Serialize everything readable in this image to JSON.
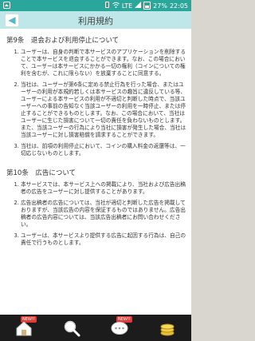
{
  "statusbar": {
    "carrier_icon": "app-icon",
    "network": "LTE",
    "battery": "27%",
    "time": "22:05"
  },
  "header": {
    "title": "利用規約",
    "back_icon": "back-icon"
  },
  "sections": [
    {
      "heading": "第9条　退会および利用停止について",
      "items": [
        "ユーザーは、自身の判断で本サービスのアプリケーションを削除することで本サービスを退会することができます。なお、この場合において、ユーザーは本サービスにかかる一切の権利（コインについての権利を含むが、これに限らない）を放棄することに同意する。",
        "当社は、ユーザーが第6条に定める禁止行為を行った場合、またはユーザーの利用が本規約若しくは本サービスの趣旨に違反している等、ユーザーによる本サービスの利用が不適切と判断した時点で、当該ユーザーへの事前の告知なく当該ユーザーの利用を一時停止、または停止することができるものとします。なお、この場合において、当社はユーザーに生じた損害について一切の責任を負わないものとします。また、当該ユーザーの行為により当社に損害が発生した場合、当社は当該ユーザーに対し損害賠償を請求することができます。",
        "当社は、前項の利用停止において、コインの購入料金の返還等は、一切応じないものとします。"
      ]
    },
    {
      "heading": "第10条　広告について",
      "items": [
        "本サービスでは、本サービス上への掲載により、当社および広告出稿者の広告をユーザーに対し提供することがあります。",
        "広告出稿者の広告については、当社が適切と判断した広告を掲載しておりますが、当該広告の内容を保証するものではありません。広告出稿者の広告内容については、当該広告出稿者にお問い合わせください。",
        "ユーザーは、本サービスより提供する広告に起因する行為は、自己の責任で行うものとします。"
      ]
    }
  ],
  "tabbar": {
    "items": [
      {
        "icon": "house-icon",
        "badge": "NEW!!"
      },
      {
        "icon": "search-icon",
        "badge": ""
      },
      {
        "icon": "chat-bubble-icon",
        "badge": "NEW!!"
      },
      {
        "icon": "coins-icon",
        "badge": ""
      }
    ]
  },
  "colors": {
    "status_bar": "#2aa69a",
    "title_bar": "#bfe7e9",
    "tab_bar": "#1c1c1c",
    "badge": "#e53935"
  }
}
